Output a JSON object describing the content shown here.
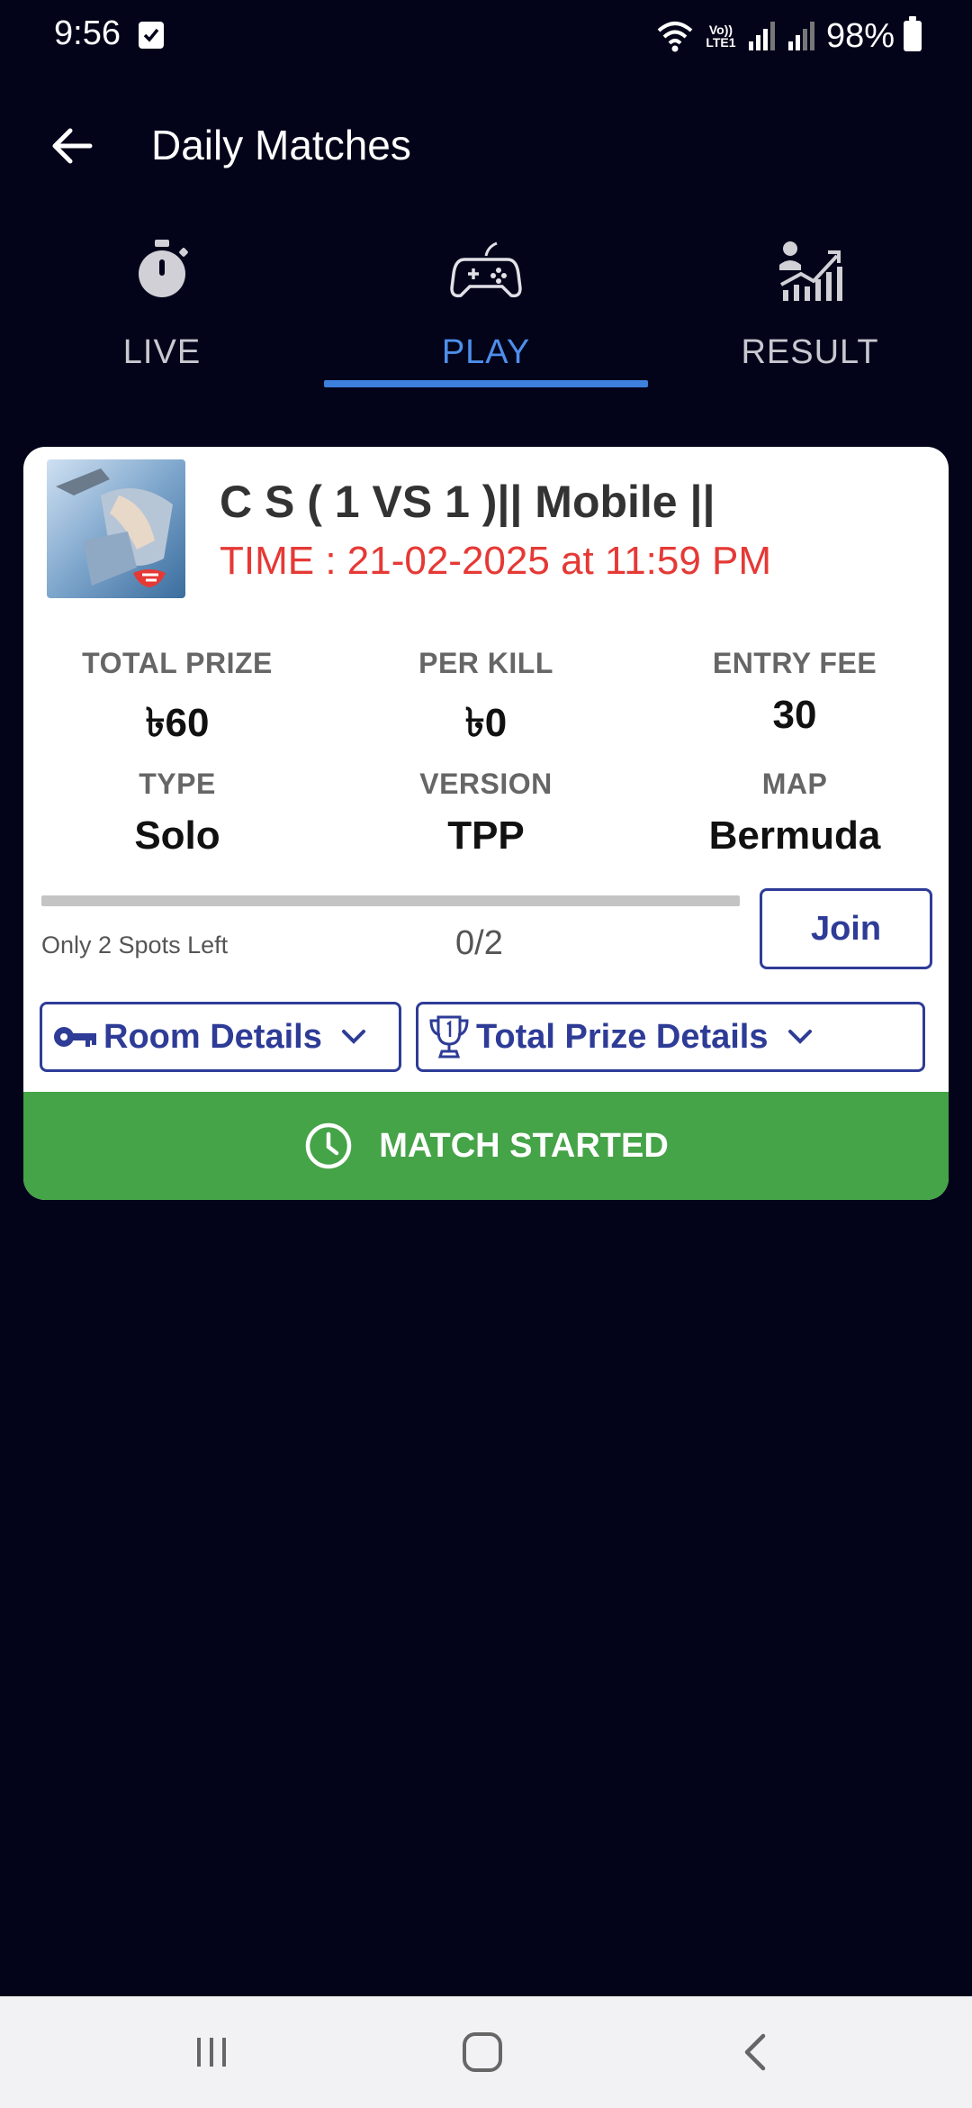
{
  "status_bar": {
    "time": "9:56",
    "lte_label": "Vo)) LTE1",
    "battery_pct": "98%"
  },
  "header": {
    "title": "Daily Matches"
  },
  "tabs": [
    {
      "label": "LIVE",
      "icon": "stopwatch-icon"
    },
    {
      "label": "PLAY",
      "icon": "gamepad-icon"
    },
    {
      "label": "RESULT",
      "icon": "leaderboard-chart-icon"
    }
  ],
  "active_tab": "PLAY",
  "match": {
    "title": "C S ( 1 VS 1 )|| Mobile ||",
    "time": "TIME : 21-02-2025 at 11:59 PM",
    "stats": {
      "total_prize_label": "TOTAL PRIZE",
      "total_prize_value": "৳60",
      "per_kill_label": "PER KILL",
      "per_kill_value": "৳0",
      "entry_fee_label": "ENTRY FEE",
      "entry_fee_value": "30",
      "type_label": "TYPE",
      "type_value": "Solo",
      "version_label": "VERSION",
      "version_value": "TPP",
      "map_label": "MAP",
      "map_value": "Bermuda"
    },
    "spots_left": "Only 2 Spots Left",
    "spots_count": "0/2",
    "progress_fraction": 0,
    "join_label": "Join",
    "room_details_label": "Room Details",
    "prize_details_label": "Total Prize Details",
    "status_label": "MATCH STARTED"
  },
  "colors": {
    "background": "#03031a",
    "accent_blue": "#3d7fdc",
    "button_blue": "#2e3c97",
    "time_red": "#e53935",
    "started_green": "#45a348"
  }
}
